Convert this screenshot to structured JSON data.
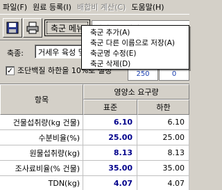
{
  "menubar": [
    {
      "label": "파일(F)",
      "disabled": false
    },
    {
      "label": "원료 등록(I)",
      "disabled": false
    },
    {
      "label": "배합비 계산(C)",
      "disabled": true
    },
    {
      "label": "도움말(H)",
      "disabled": false
    }
  ],
  "toolbar": {
    "save_icon": "save-icon",
    "print_icon": "print-icon",
    "menu_button_label": "축군 메뉴",
    "field_text": "거세우 육성기"
  },
  "popup_menu": [
    "축군 추가(A)",
    "축군 다른 이름으로 저장(A)",
    "축군명 수정(E)",
    "축군 삭제(D)"
  ],
  "form": {
    "group_label": "축종:",
    "group_value": "거세우 육성 및",
    "checkbox_checked": true,
    "checkbox_label": "조단백질 하한을 10%로 설정",
    "small_value": "250",
    "small_value2": "0"
  },
  "table": {
    "item_header": "항목",
    "group_header": "영양소 요구량",
    "col_headers": [
      "표준",
      "하한"
    ],
    "rows": [
      {
        "label": "건물섭취량(kg 건물)",
        "standard": "6.10",
        "lower": "6.10"
      },
      {
        "label": "수분비율(%)",
        "standard": "25.00",
        "lower": "25.00"
      },
      {
        "label": "원물섭취량(kg)",
        "standard": "8.13",
        "lower": "8.13"
      },
      {
        "label": "조사료비율(% 건물)",
        "standard": "35.00",
        "lower": "35.00"
      },
      {
        "label": "TDN(kg)",
        "standard": "4.07",
        "lower": "4.07"
      }
    ]
  }
}
